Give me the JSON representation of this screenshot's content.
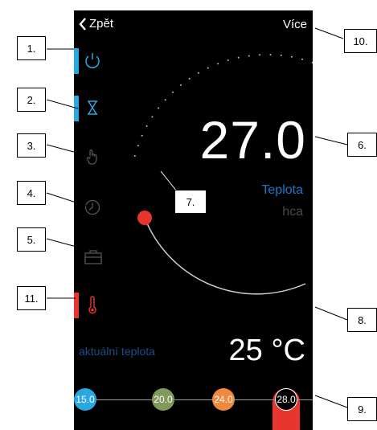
{
  "header": {
    "back_label": "Zpět",
    "more_label": "Více"
  },
  "sidebar": [
    {
      "icon": "power-icon",
      "color": "#29a8e0",
      "bar_color": "#29a8e0"
    },
    {
      "icon": "hourglass-icon",
      "color": "#29a8e0",
      "bar_color": "#29a8e0"
    },
    {
      "icon": "hand-icon",
      "color": "#555555",
      "bar_color": ""
    },
    {
      "icon": "clock-icon",
      "color": "#555555",
      "bar_color": ""
    },
    {
      "icon": "suitcase-icon",
      "color": "#555555",
      "bar_color": ""
    },
    {
      "icon": "thermometer-icon",
      "color": "#e8362e",
      "bar_color": "#e8362e"
    }
  ],
  "thermostat": {
    "setpoint": "27.0",
    "mode_label": "Teplota",
    "sub_label": "hca"
  },
  "current": {
    "label": "aktuální teplota",
    "value": "25 °C"
  },
  "presets": [
    {
      "label": "15.0",
      "color": "#29a8e0"
    },
    {
      "label": "20.0",
      "color": "#7f9a5b"
    },
    {
      "label": "24.0",
      "color": "#f0883e"
    },
    {
      "label": "28.0",
      "color": "#000000",
      "selected": true
    }
  ],
  "callouts": [
    "1.",
    "2.",
    "3.",
    "4.",
    "5.",
    "11.",
    "7.",
    "10.",
    "6.",
    "8.",
    "9."
  ],
  "colors": {
    "accent_blue": "#29a8e0",
    "accent_red": "#e8362e"
  }
}
